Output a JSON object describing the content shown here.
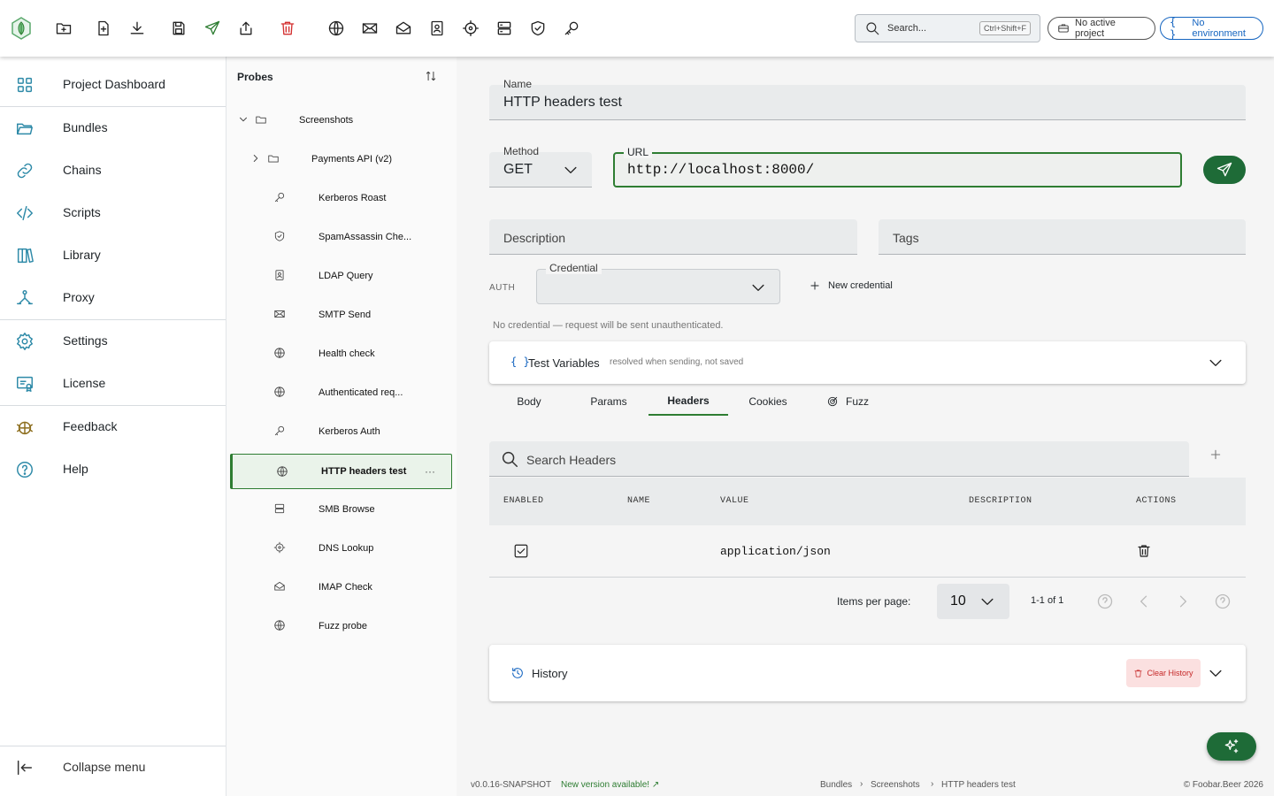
{
  "toolbar": {
    "search_placeholder": "Search...",
    "search_shortcut": "Ctrl+Shift+F",
    "project_pill": "No active project",
    "environment_pill": "No environment"
  },
  "sidebar": {
    "items": [
      {
        "label": "Project Dashboard",
        "icon": "grid-icon"
      },
      {
        "label": "Bundles",
        "icon": "folder-open-icon"
      },
      {
        "label": "Chains",
        "icon": "link-icon"
      },
      {
        "label": "Scripts",
        "icon": "code-icon"
      },
      {
        "label": "Library",
        "icon": "books-icon"
      },
      {
        "label": "Proxy",
        "icon": "proxy-icon"
      },
      {
        "label": "Settings",
        "icon": "gear-icon"
      },
      {
        "label": "License",
        "icon": "license-icon"
      },
      {
        "label": "Feedback",
        "icon": "bug-icon"
      },
      {
        "label": "Help",
        "icon": "help-icon"
      }
    ],
    "collapse_label": "Collapse menu"
  },
  "probes": {
    "title": "Probes",
    "tree": [
      {
        "label": "Screenshots",
        "icon": "folder-icon"
      },
      {
        "label": "Payments API (v2)",
        "icon": "folder-icon"
      },
      {
        "label": "Kerberos Roast",
        "icon": "key-icon"
      },
      {
        "label": "SpamAssassin Che...",
        "icon": "shield-check-icon"
      },
      {
        "label": "LDAP Query",
        "icon": "contact-book-icon"
      },
      {
        "label": "SMTP Send",
        "icon": "envelope-icon"
      },
      {
        "label": "Health check",
        "icon": "globe-icon"
      },
      {
        "label": "Authenticated req...",
        "icon": "globe-icon"
      },
      {
        "label": "Kerberos Auth",
        "icon": "key-icon"
      },
      {
        "label": "HTTP headers test",
        "icon": "globe-icon"
      },
      {
        "label": "SMB Browse",
        "icon": "server-icon"
      },
      {
        "label": "DNS Lookup",
        "icon": "crosshair-icon"
      },
      {
        "label": "IMAP Check",
        "icon": "envelope-open-icon"
      },
      {
        "label": "Fuzz probe",
        "icon": "globe-icon"
      }
    ],
    "selected_more": "···"
  },
  "form": {
    "name_label": "Name",
    "name_value": "HTTP headers test",
    "method_label": "Method",
    "method_value": "GET",
    "url_label": "URL",
    "url_value": "http://localhost:8000/",
    "description_placeholder": "Description",
    "tags_placeholder": "Tags",
    "auth_label": "AUTH",
    "credential_label": "Credential",
    "new_credential": "New credential",
    "auth_note": "No credential — request will be sent unauthenticated."
  },
  "test_variables": {
    "title": "Test Variables",
    "hint": "resolved when sending, not saved"
  },
  "tabs": [
    {
      "label": "Body"
    },
    {
      "label": "Params"
    },
    {
      "label": "Headers"
    },
    {
      "label": "Cookies"
    },
    {
      "label": "Fuzz"
    }
  ],
  "headers_table": {
    "search_placeholder": "Search Headers",
    "columns": [
      "ENABLED",
      "NAME",
      "VALUE",
      "DESCRIPTION",
      "ACTIONS"
    ],
    "rows": [
      {
        "enabled": true,
        "name": "",
        "value": "application/json",
        "description": ""
      }
    ],
    "items_per_page_label": "Items per page:",
    "items_per_page": "10",
    "range": "1-1 of 1"
  },
  "history": {
    "title": "History",
    "clear_label": "Clear History"
  },
  "footer": {
    "version": "v0.0.16-SNAPSHOT",
    "update": "New version available! ↗",
    "breadcrumb": [
      "Bundles",
      "Screenshots",
      "HTTP headers test"
    ],
    "copyright": "© Foobar.Beer 2026"
  },
  "colors": {
    "accent": "#2e7d32",
    "sidebar_icon": "#2e8aa8",
    "environment": "#1565c0",
    "danger": "#d32f2f"
  }
}
